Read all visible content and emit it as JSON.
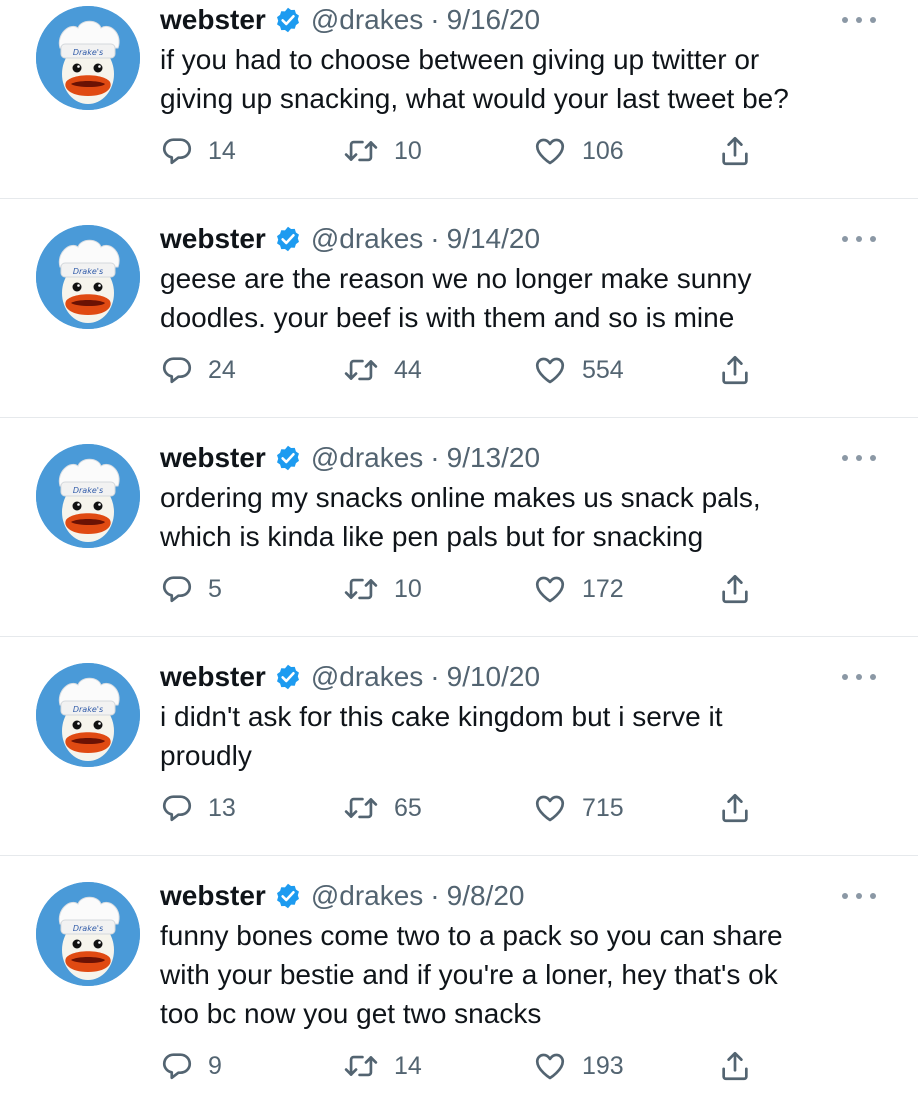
{
  "tweets": [
    {
      "name": "webster",
      "handle": "@drakes",
      "separator": "·",
      "date": "9/16/20",
      "lines": [
        "if you had to choose between giving up twitter or",
        "giving up snacking, what would your last tweet be?"
      ],
      "replies": "14",
      "retweets": "10",
      "likes": "106"
    },
    {
      "name": "webster",
      "handle": "@drakes",
      "separator": "·",
      "date": "9/14/20",
      "lines": [
        "geese are the reason we no longer make sunny",
        "doodles. your beef is with them and so is mine"
      ],
      "replies": "24",
      "retweets": "44",
      "likes": "554"
    },
    {
      "name": "webster",
      "handle": "@drakes",
      "separator": "·",
      "date": "9/13/20",
      "lines": [
        "ordering my snacks online makes us snack pals,",
        "which is kinda like pen pals but for snacking"
      ],
      "replies": "5",
      "retweets": "10",
      "likes": "172"
    },
    {
      "name": "webster",
      "handle": "@drakes",
      "separator": "·",
      "date": "9/10/20",
      "lines": [
        "i didn't ask for this cake kingdom but i serve it",
        "proudly"
      ],
      "replies": "13",
      "retweets": "65",
      "likes": "715"
    },
    {
      "name": "webster",
      "handle": "@drakes",
      "separator": "·",
      "date": "9/8/20",
      "lines": [
        "funny bones come two to a pack so you can share",
        "with your bestie and if you're a loner, hey that's ok",
        "too bc now you get two snacks"
      ],
      "replies": "9",
      "retweets": "14",
      "likes": "193"
    }
  ],
  "avatar_hat_text": "Drake's",
  "icons": {
    "reply": "reply-icon",
    "retweet": "retweet-icon",
    "like": "heart-icon",
    "share": "share-icon",
    "verified": "verified-badge-icon",
    "more": "more-options-icon"
  },
  "colors": {
    "verified": "#1d9bf0",
    "avatar_bg": "#4a9ad8",
    "muted": "#536471",
    "text": "#0f1419",
    "divider": "#e6e9ec"
  }
}
